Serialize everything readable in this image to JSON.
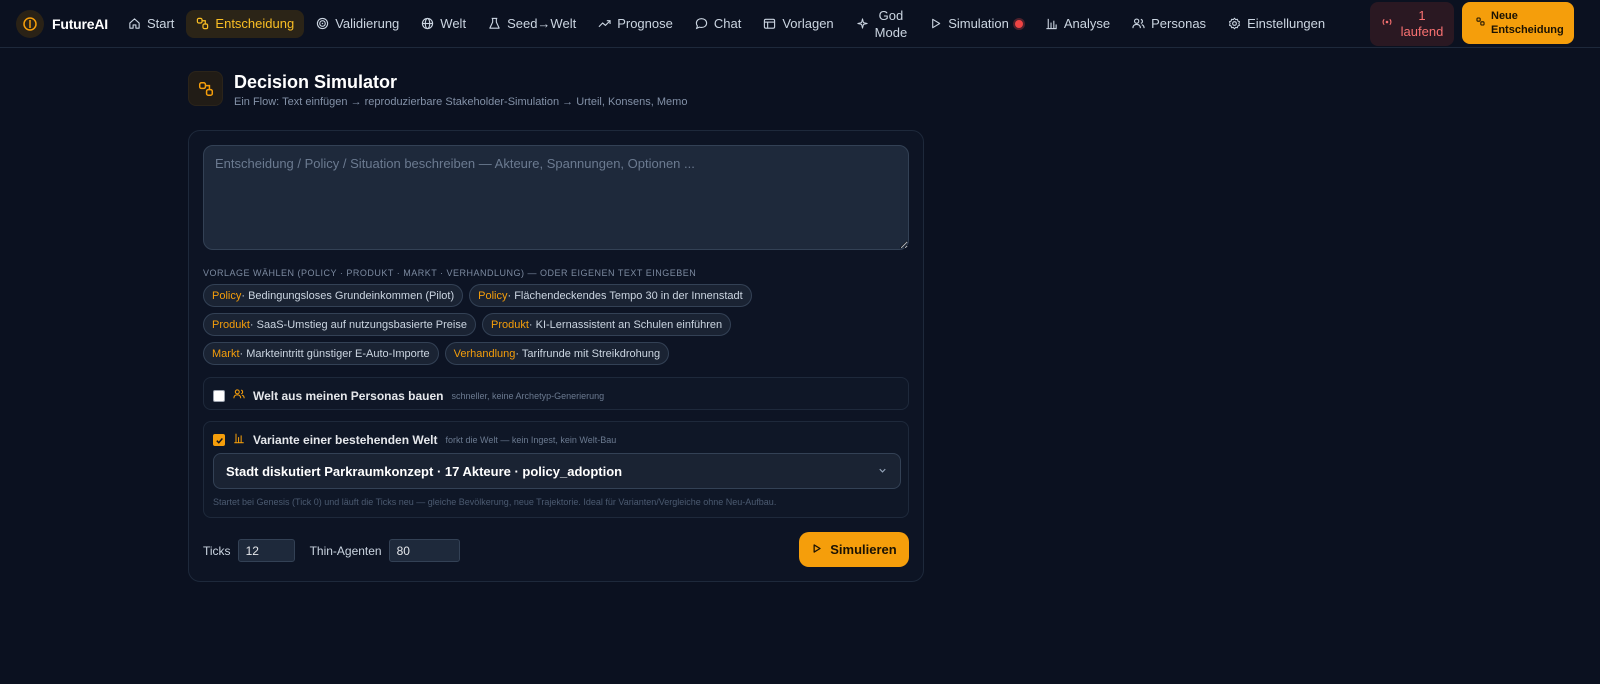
{
  "brand": {
    "name": "FutureAI"
  },
  "nav": {
    "items": [
      {
        "label": "Start",
        "icon": "home-icon"
      },
      {
        "label": "Entscheidung",
        "icon": "decision-icon",
        "active": true
      },
      {
        "label": "Validierung",
        "icon": "target-icon"
      },
      {
        "label": "Welt",
        "icon": "globe-icon"
      },
      {
        "label": "Seed→Welt",
        "icon": "flask-icon"
      },
      {
        "label": "Prognose",
        "icon": "trending-up-icon"
      },
      {
        "label": "Chat",
        "icon": "chat-icon"
      },
      {
        "label": "Vorlagen",
        "icon": "template-icon"
      },
      {
        "label": "God",
        "label2": "Mode",
        "icon": "sparkle-icon"
      },
      {
        "label": "Simulation",
        "icon": "play-icon"
      },
      {
        "label": "Analyse",
        "icon": "bar-chart-icon"
      },
      {
        "label": "Personas",
        "icon": "users-icon"
      },
      {
        "label": "Einstellungen",
        "icon": "gear-icon"
      }
    ],
    "running_count": "1",
    "running_label": "laufend",
    "new_label_1": "Neue",
    "new_label_2": "Entscheidung"
  },
  "header": {
    "title": "Decision Simulator",
    "subtitle": "Ein Flow: Text einfügen → reproduzierbare Stakeholder-Simulation → Urteil, Konsens, Memo"
  },
  "form": {
    "placeholder": "Entscheidung / Policy / Situation beschreiben — Akteure, Spannungen, Optionen ...",
    "template_label": "Vorlage wählen (Policy · Produkt · Markt · Verhandlung) — oder eigenen Text eingeben",
    "templates": [
      [
        {
          "cat": "Policy",
          "text": " · Bedingungsloses Grundeinkommen (Pilot)"
        },
        {
          "cat": "Policy",
          "text": " · Flächendeckendes Tempo 30 in der Innenstadt"
        }
      ],
      [
        {
          "cat": "Produkt",
          "text": " · SaaS-Umstieg auf nutzungsbasierte Preise"
        },
        {
          "cat": "Produkt",
          "text": " · KI-Lernassistent an Schulen einführen"
        }
      ],
      [
        {
          "cat": "Markt",
          "text": " · Markteintritt günstiger E-Auto-Importe"
        },
        {
          "cat": "Verhandlung",
          "text": " · Tarifrunde mit Streikdrohung"
        }
      ]
    ],
    "option_personas": {
      "title": "Welt aus meinen Personas bauen",
      "hint": "schneller, keine Archetyp-Generierung",
      "checked": false
    },
    "option_variant": {
      "title": "Variante einer bestehenden Welt",
      "hint": "forkt die Welt — kein Ingest, kein Welt-Bau",
      "checked": true,
      "selected_world": "Stadt diskutiert Parkraumkonzept · 17 Akteure · policy_adoption",
      "footnote": "Startet bei Genesis (Tick 0) und läuft die Ticks neu — gleiche Bevölkerung, neue Trajektorie. Ideal für Varianten/Vergleiche ohne Neu-Aufbau."
    },
    "ticks_label": "Ticks",
    "ticks_value": "12",
    "thin_label": "Thin-Agenten",
    "thin_value": "80",
    "submit_label": "Simulieren"
  },
  "colors": {
    "accent": "#f59e0b",
    "background": "#0b1120",
    "danger": "#ef4444"
  }
}
